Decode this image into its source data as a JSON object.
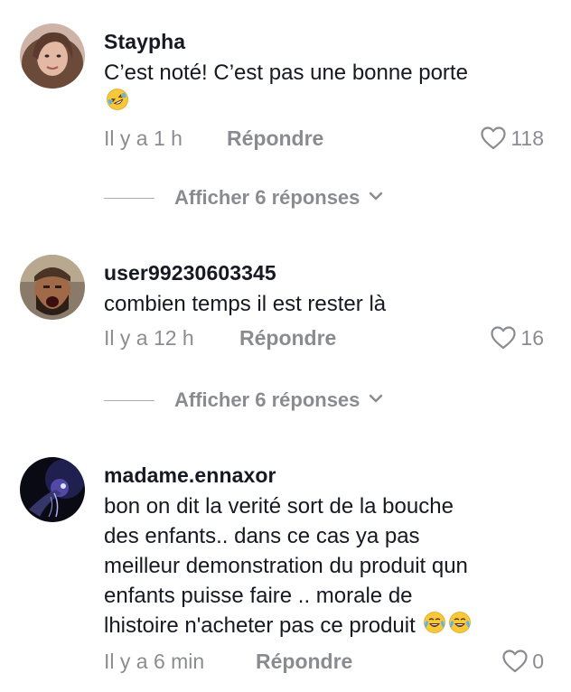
{
  "comments": [
    {
      "username": "Staypha",
      "text": "C’est noté! C’est pas une bonne porte",
      "emoji": "rolling-on-floor-laughing",
      "time": "Il y a 1 h",
      "reply_label": "Répondre",
      "likes": "118",
      "replies_label": "Afficher 6 réponses"
    },
    {
      "username": "user99230603345",
      "text": "combien temps il est rester là",
      "time": "Il y a 12 h",
      "reply_label": "Répondre",
      "likes": "16",
      "replies_label": "Afficher 6 réponses"
    },
    {
      "username": "madame.ennaxor",
      "text_lines": [
        "bon on dit la verité sort de la bouche",
        "des enfants.. dans ce cas ya pas",
        "meilleur demonstration du produit qun",
        "enfants puisse faire .. morale de",
        "lhistoire n'acheter pas ce produit"
      ],
      "emoji": "face-with-tears-of-joy x2",
      "time": "Il y a 6 min",
      "reply_label": "Répondre",
      "likes": "0"
    }
  ],
  "colors": {
    "text": "#161823",
    "muted": "rgba(22,24,35,0.5)",
    "background": "#ffffff"
  }
}
